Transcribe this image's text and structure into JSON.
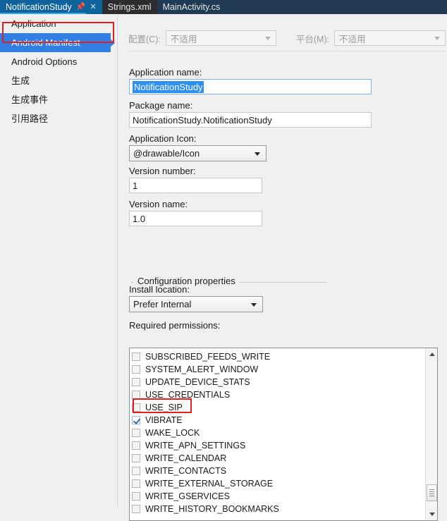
{
  "tabs": [
    {
      "label": "NotificationStudy",
      "state": "active",
      "pin_icon": "pin-icon",
      "close_icon": "close-icon"
    },
    {
      "label": "Strings.xml",
      "state": "inactive"
    },
    {
      "label": "MainActivity.cs",
      "state": "inactive-plain"
    }
  ],
  "sidebar": {
    "items": [
      {
        "label": "Application",
        "selected": false
      },
      {
        "label": "Android Manifest",
        "selected": true
      },
      {
        "label": "Android Options",
        "selected": false
      },
      {
        "label": "生成",
        "selected": false
      },
      {
        "label": "生成事件",
        "selected": false
      },
      {
        "label": "引用路径",
        "selected": false
      }
    ]
  },
  "config_row": {
    "config_label": "配置(C):",
    "config_value": "不适用",
    "platform_label": "平台(M):",
    "platform_value": "不适用",
    "disabled": true
  },
  "form": {
    "application_name_label": "Application name:",
    "application_name_value": "NotificationStudy",
    "package_name_label": "Package name:",
    "package_name_value": "NotificationStudy.NotificationStudy",
    "application_icon_label": "Application Icon:",
    "application_icon_value": "@drawable/Icon",
    "version_number_label": "Version number:",
    "version_number_value": "1",
    "version_name_label": "Version name:",
    "version_name_value": "1.0"
  },
  "group": {
    "title": "Configuration properties",
    "install_location_label": "Install location:",
    "install_location_value": "Prefer Internal",
    "required_permissions_label": "Required permissions:"
  },
  "permissions": [
    {
      "name": "SUBSCRIBED_FEEDS_WRITE",
      "checked": false
    },
    {
      "name": "SYSTEM_ALERT_WINDOW",
      "checked": false
    },
    {
      "name": "UPDATE_DEVICE_STATS",
      "checked": false
    },
    {
      "name": "USE_CREDENTIALS",
      "checked": false
    },
    {
      "name": "USE_SIP",
      "checked": false
    },
    {
      "name": "VIBRATE",
      "checked": true
    },
    {
      "name": "WAKE_LOCK",
      "checked": false
    },
    {
      "name": "WRITE_APN_SETTINGS",
      "checked": false
    },
    {
      "name": "WRITE_CALENDAR",
      "checked": false
    },
    {
      "name": "WRITE_CONTACTS",
      "checked": false
    },
    {
      "name": "WRITE_EXTERNAL_STORAGE",
      "checked": false
    },
    {
      "name": "WRITE_GSERVICES",
      "checked": false
    },
    {
      "name": "WRITE_HISTORY_BOOKMARKS",
      "checked": false
    }
  ],
  "scrollbar": {
    "up_icon": "scroll-up-arrow-icon",
    "down_icon": "scroll-down-arrow-icon"
  },
  "colors": {
    "accent_blue": "#2f7fe4",
    "tab_active": "#0e639c",
    "annotation_red": "#e02020",
    "selection_blue": "#2f8ff0"
  }
}
